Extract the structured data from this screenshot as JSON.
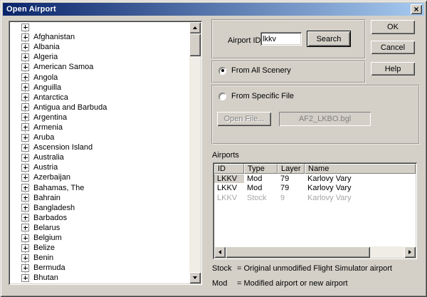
{
  "window": {
    "title": "Open Airport"
  },
  "icons": {
    "close": "×",
    "expand": "+"
  },
  "tree": {
    "items": [
      "",
      "Afghanistan",
      "Albania",
      "Algeria",
      "American Samoa",
      "Angola",
      "Anguilla",
      "Antarctica",
      "Antigua and Barbuda",
      "Argentina",
      "Armenia",
      "Aruba",
      "Ascension Island",
      "Australia",
      "Austria",
      "Azerbaijan",
      "Bahamas, The",
      "Bahrain",
      "Bangladesh",
      "Barbados",
      "Belarus",
      "Belgium",
      "Belize",
      "Benin",
      "Bermuda",
      "Bhutan"
    ]
  },
  "search": {
    "label": "Airport ID",
    "value": "lkkv",
    "button_label": "Search"
  },
  "source": {
    "all_scenery_label": "From All Scenery",
    "all_scenery_selected": true,
    "specific_file_label": "From Specific File",
    "specific_file_selected": false,
    "open_file_button_label": "Open File...",
    "file_name": "AF2_LKBO.bgl"
  },
  "airports": {
    "section_label": "Airports",
    "columns": [
      "ID",
      "Type",
      "Layer",
      "Name"
    ],
    "rows": [
      {
        "id": "LKKV",
        "type": "Mod",
        "layer": "79",
        "name": "Karlovy Vary",
        "selected": true,
        "disabled": false
      },
      {
        "id": "LKKV",
        "type": "Mod",
        "layer": "79",
        "name": "Karlovy Vary",
        "selected": false,
        "disabled": false
      },
      {
        "id": "LKKV",
        "type": "Stock",
        "layer": "9",
        "name": "Karlovy Vary",
        "selected": false,
        "disabled": true
      }
    ]
  },
  "footnotes": [
    {
      "term": "Stock",
      "rest": "= Original unmodified Flight Simulator airport"
    },
    {
      "term": "Mod",
      "rest": "= Modified airport or new airport"
    }
  ],
  "buttons": {
    "ok": "OK",
    "cancel": "Cancel",
    "help": "Help"
  },
  "colors": {
    "titlebar_start": "#0a246a",
    "titlebar_end": "#a6caf0",
    "dialog_face": "#d4d0c8",
    "selection_bg": "#d4d0c8",
    "disabled_text": "#a6a6a6"
  }
}
